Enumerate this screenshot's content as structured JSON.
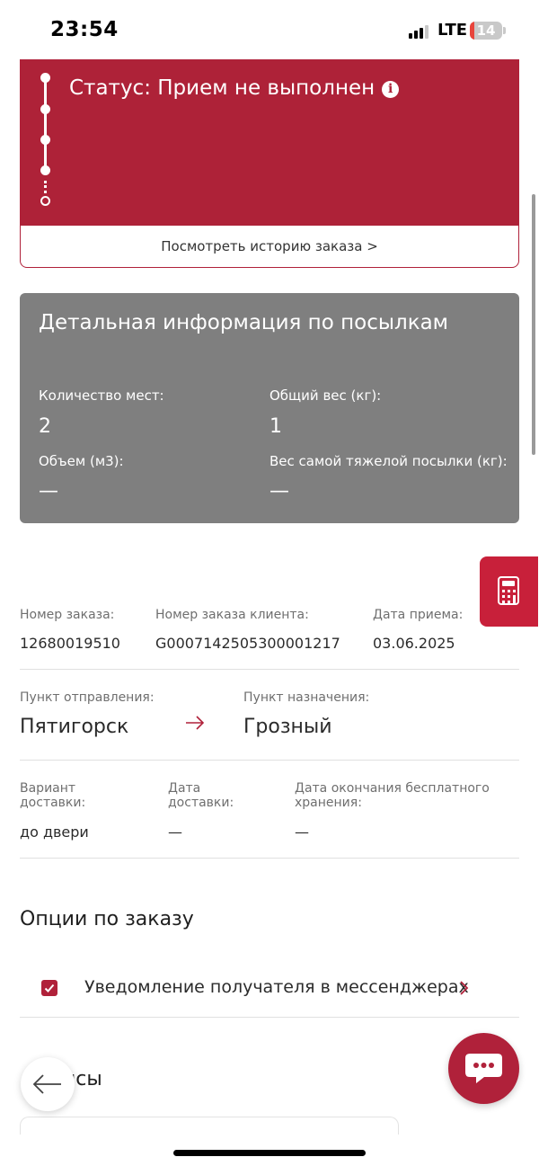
{
  "status_bar": {
    "time": "23:54",
    "network": "LTE",
    "battery": "14"
  },
  "status_card": {
    "title": "Статус: Прием не выполнен",
    "history_link": "Посмотреть историю заказа >"
  },
  "parcels": {
    "title": "Детальная информация по посылкам",
    "places_label": "Количество мест:",
    "places_value": "2",
    "weight_label": "Общий вес (кг):",
    "weight_value": "1",
    "volume_label": "Объем (м3):",
    "volume_value": "—",
    "heaviest_label": "Вес самой тяжелой посылки (кг):",
    "heaviest_value": "—"
  },
  "order": {
    "number_label": "Номер заказа:",
    "number_value": "12680019510",
    "client_number_label": "Номер заказа клиента:",
    "client_number_value": "G0007142505300001217",
    "accept_date_label": "Дата приема:",
    "accept_date_value": "03.06.2025",
    "from_label": "Пункт отправления:",
    "from_value": "Пятигорск",
    "to_label": "Пункт назначения:",
    "to_value": "Грозный",
    "delivery_type_label": "Вариант доставки:",
    "delivery_type_value": "до двери",
    "delivery_date_label": "Дата доставки:",
    "delivery_date_value": "—",
    "storage_end_label": "Дата окончания бесплатного хранения:",
    "storage_end_value": "—"
  },
  "options": {
    "title": "Опции по заказу",
    "items": [
      {
        "label": "Уведомление получателя в мессенджерах",
        "checked": true
      }
    ]
  },
  "services": {
    "title_partial": "исы"
  },
  "icons": {
    "info": "info-icon",
    "calculator": "calculator-icon",
    "arrow": "arrow-right-icon",
    "chevron": "chevron-right-icon",
    "back": "arrow-left-icon",
    "chat": "chat-bubble-icon"
  },
  "colors": {
    "accent": "#ae2238",
    "card_gray": "#7f7f7f"
  }
}
